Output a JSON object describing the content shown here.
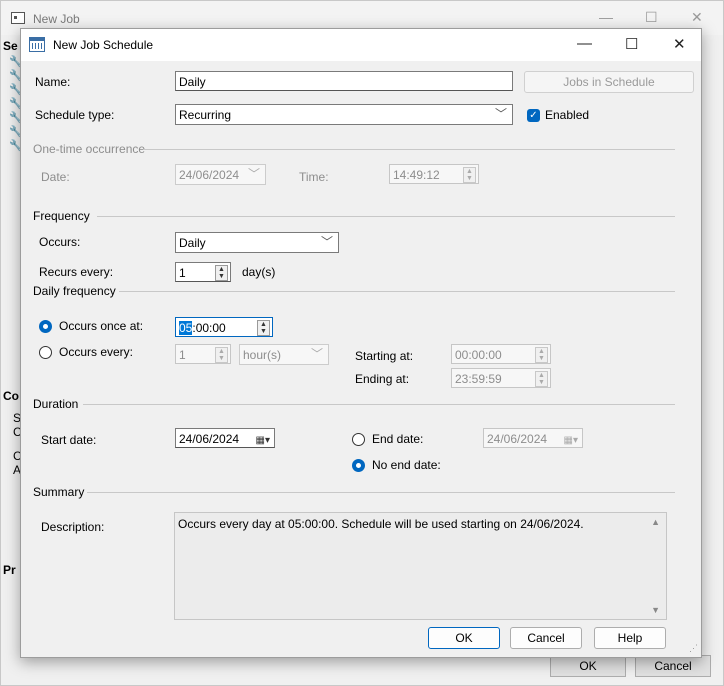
{
  "background": {
    "title": "New Job",
    "left_labels": [
      "Se",
      "Co",
      "S",
      "C",
      "C",
      "A",
      "Pr"
    ],
    "ok": "OK",
    "cancel": "Cancel"
  },
  "dialog": {
    "title": "New Job Schedule",
    "name_label": "Name:",
    "name_value": "Daily",
    "jobs_in_schedule": "Jobs in Schedule",
    "schedule_type_label": "Schedule type:",
    "schedule_type_value": "Recurring",
    "enabled_label": "Enabled",
    "one_time": {
      "heading": "One-time occurrence",
      "date_label": "Date:",
      "date_value": "24/06/2024",
      "time_label": "Time:",
      "time_value": "14:49:12"
    },
    "frequency": {
      "heading": "Frequency",
      "occurs_label": "Occurs:",
      "occurs_value": "Daily",
      "recurs_label": "Recurs every:",
      "recurs_value": "1",
      "recurs_unit": "day(s)"
    },
    "daily_frequency": {
      "heading": "Daily frequency",
      "once_label": "Occurs once at:",
      "once_value_hour": "05",
      "once_value_rest": ":00:00",
      "every_label": "Occurs every:",
      "every_value": "1",
      "every_unit": "hour(s)",
      "starting_label": "Starting at:",
      "starting_value": "00:00:00",
      "ending_label": "Ending at:",
      "ending_value": "23:59:59"
    },
    "duration": {
      "heading": "Duration",
      "start_label": "Start date:",
      "start_value": "24/06/2024",
      "end_label": "End date:",
      "end_value": "24/06/2024",
      "no_end_label": "No end date:"
    },
    "summary": {
      "heading": "Summary",
      "description_label": "Description:",
      "description_value": "Occurs every day at 05:00:00. Schedule will be used starting on 24/06/2024."
    },
    "buttons": {
      "ok": "OK",
      "cancel": "Cancel",
      "help": "Help"
    }
  },
  "colors": {
    "accent": "#0067c0",
    "disabled_text": "#8d8d8d"
  }
}
